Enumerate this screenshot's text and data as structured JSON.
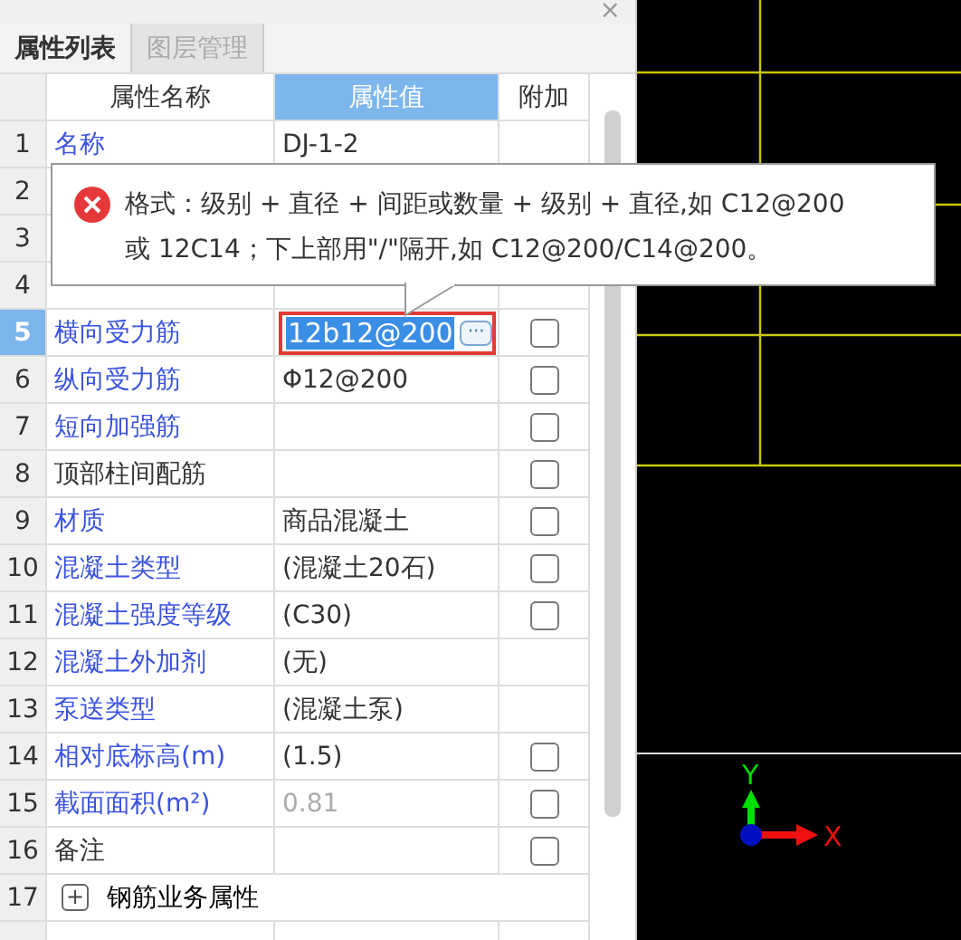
{
  "panel": {
    "close": "×",
    "tabs": [
      {
        "label": "属性列表",
        "selected": true
      },
      {
        "label": "图层管理",
        "selected": false
      }
    ]
  },
  "table": {
    "columns": [
      {
        "label": "属性名称",
        "selected": false
      },
      {
        "label": "属性值",
        "selected": true
      },
      {
        "label": "附加",
        "selected": false
      }
    ],
    "rows": [
      {
        "index": "1",
        "name": "名称",
        "value": "DJ-1-2",
        "highlighted": true,
        "selected": false
      },
      {
        "index": "2",
        "selected": false
      },
      {
        "index": "3",
        "selected": false
      },
      {
        "index": "4",
        "selected": false
      },
      {
        "index": "5",
        "name": "横向受力筋",
        "value": "12b12@200",
        "highlighted": true,
        "selected": true,
        "editing": true,
        "more": "···",
        "checkbox": {
          "checked": false
        }
      },
      {
        "index": "6",
        "name": "纵向受力筋",
        "value": "Φ12@200",
        "highlighted": true,
        "selected": false,
        "checkbox": {
          "checked": false
        }
      },
      {
        "index": "7",
        "name": "短向加强筋",
        "highlighted": true,
        "selected": false,
        "checkbox": {
          "checked": false
        }
      },
      {
        "index": "8",
        "name": "顶部柱间配筋",
        "highlighted": false,
        "selected": false,
        "checkbox": {
          "checked": false
        }
      },
      {
        "index": "9",
        "name": "材质",
        "value": "商品混凝土",
        "highlighted": true,
        "selected": false,
        "checkbox": {
          "checked": false
        }
      },
      {
        "index": "10",
        "name": "混凝土类型",
        "value": "(混凝土20石)",
        "highlighted": true,
        "selected": false,
        "checkbox": {
          "checked": false
        }
      },
      {
        "index": "11",
        "name": "混凝土强度等级",
        "value": "(C30)",
        "highlighted": true,
        "selected": false,
        "checkbox": {
          "checked": false
        }
      },
      {
        "index": "12",
        "name": "混凝土外加剂",
        "value": "(无)",
        "highlighted": true,
        "selected": false
      },
      {
        "index": "13",
        "name": "泵送类型",
        "value": "(混凝土泵)",
        "highlighted": true,
        "selected": false
      },
      {
        "index": "14",
        "name": "相对底标高(m)",
        "value": "(1.5)",
        "highlighted": true,
        "selected": false,
        "checkbox": {
          "checked": false
        }
      },
      {
        "index": "15",
        "name": "截面面积(m²)",
        "value": "0.81",
        "highlighted": true,
        "disabled": true,
        "selected": false,
        "checkbox": {
          "checked": false
        }
      },
      {
        "index": "16",
        "name": "备注",
        "highlighted": false,
        "selected": false,
        "checkbox": {
          "checked": false
        }
      },
      {
        "index": "17",
        "name": "钢筋业务属性",
        "kind": "group",
        "expand_symbol": "+",
        "selected": false
      }
    ]
  },
  "tooltip": {
    "kind": "error",
    "lines": [
      "格式：级别 + 直径 + 间距或数量 + 级别 + 直径,如 C12@200",
      "或 12C14；下上部用\"/\"隔开,如 C12@200/C14@200。"
    ]
  },
  "canvas": {
    "axis_x": "X",
    "axis_y": "Y"
  }
}
